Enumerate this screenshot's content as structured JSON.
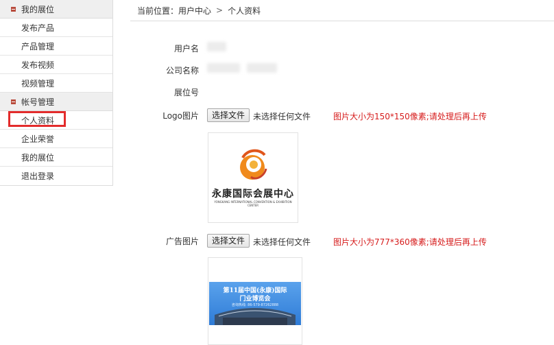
{
  "sidebar": {
    "groups": [
      {
        "title": "我的展位",
        "items": [
          "发布产品",
          "产品管理",
          "发布视频",
          "视频管理"
        ]
      },
      {
        "title": "帐号管理",
        "items": [
          "个人资料",
          "企业荣誉",
          "我的展位",
          "退出登录"
        ]
      }
    ]
  },
  "breadcrumb": {
    "prefix": "当前位置：",
    "level1": "用户中心",
    "separator": ">",
    "level2": "个人资料"
  },
  "form": {
    "username_label": "用户名",
    "company_label": "公司名称",
    "booth_label": "展位号",
    "logo_label": "Logo图片",
    "logo_button": "选择文件",
    "logo_file_text": "未选择任何文件",
    "logo_hint": "图片大小为150*150像素;请处理后再上传",
    "logo_preview": {
      "name_cn": "永康国际会展中心",
      "name_en": "YONGKANG INTERNATIONAL CONVENTION & EXHIBITION CENTER"
    },
    "ad_label": "广告图片",
    "ad_button": "选择文件",
    "ad_file_text": "未选择任何文件",
    "ad_hint": "图片大小为777*360像素;请处理后再上传",
    "ad_preview": {
      "line1": "第11届中国(永康)国际",
      "line2": "门业博览会",
      "line3": "咨询热线: 86-579-87262888"
    }
  },
  "colors": {
    "accent_red": "#d61b1b",
    "highlight_box": "#e32b2b",
    "logo_orange": "#f08a1c",
    "ad_blue": "#2e7bd6"
  }
}
